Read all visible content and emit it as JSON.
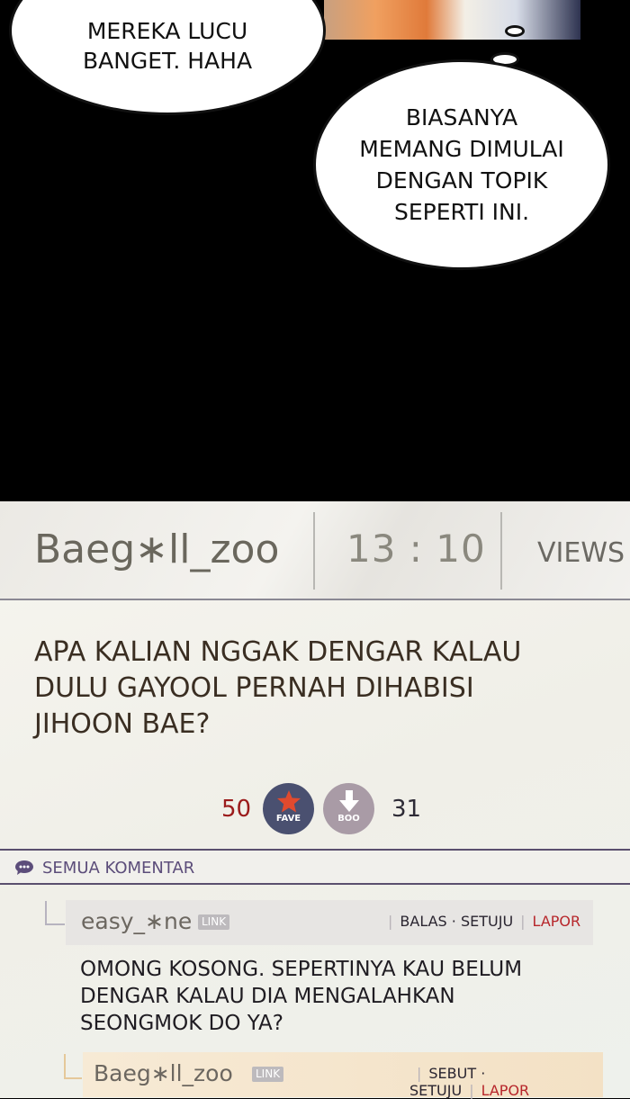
{
  "panel": {
    "bubble_left": "MEREKA LUCU\nBANGET. HAHA",
    "bubble_right": "BIASANYA\nMEMANG DIMULAI\nDENGAN TOPIK\nSEPERTI INI."
  },
  "post": {
    "author": "Baeg∗ll_zoo",
    "time": "13 : 10",
    "views_label": "VIEWS",
    "title": "APA KALIAN NGGAK DENGAR KALAU\nDULU GAYOOL PERNAH DIHABISI\nJIHOON BAE?",
    "fave_count": "50",
    "fave_label": "FAVE",
    "boo_count": "31",
    "boo_label": "BOO"
  },
  "comments_section": {
    "label": "SEMUA KOMENTAR",
    "icon": "speech-bubble-icon"
  },
  "comments": [
    {
      "author": "easy_∗ne",
      "badge": "LINK",
      "reply": "BALAS",
      "agree": "SETUJU",
      "report": "LAPOR",
      "text": "OMONG KOSONG. SEPERTINYA KAU BELUM\nDENGAR KALAU DIA MENGALAHKAN\nSEONGMOK DO YA?"
    },
    {
      "author": "Baeg∗ll_zoo",
      "badge": "LINK",
      "reply": "SEBUT",
      "agree": "SETUJU",
      "report": "LAPOR"
    }
  ],
  "colors": {
    "fave_count": "#9b1b1b",
    "fave_button": "#4a5070",
    "boo_button": "#a99ba6",
    "report": "#b7262b",
    "section_accent": "#5c4d7a"
  }
}
